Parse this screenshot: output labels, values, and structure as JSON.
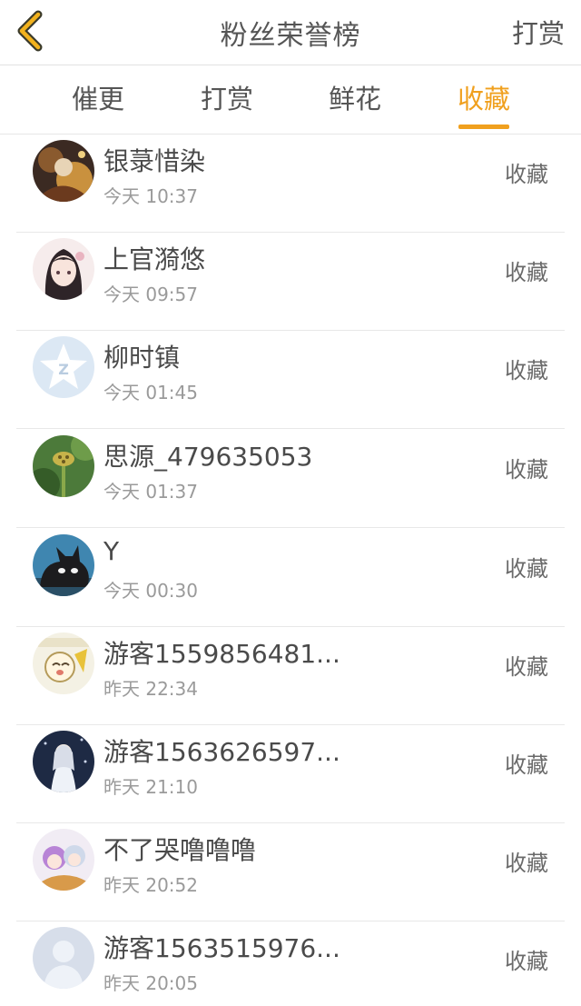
{
  "header": {
    "title": "粉丝荣誉榜",
    "action_label": "打赏",
    "back_icon": "chevron-left-icon",
    "accent_color": "#f0a01e"
  },
  "tabs": [
    {
      "label": "催更",
      "active": false
    },
    {
      "label": "打赏",
      "active": false
    },
    {
      "label": "鲜花",
      "active": false
    },
    {
      "label": "收藏",
      "active": true
    }
  ],
  "fans": [
    {
      "name": "银菉惜染",
      "time": "今天 10:37",
      "action": "收藏",
      "avatar": "anime-girl-dark-avatar"
    },
    {
      "name": "上官漪悠",
      "time": "今天 09:57",
      "action": "收藏",
      "avatar": "anime-girl-portrait-avatar"
    },
    {
      "name": "柳时镇",
      "time": "今天 01:45",
      "action": "收藏",
      "avatar": "qq-star-avatar"
    },
    {
      "name": "思源_479635053",
      "time": "今天 01:37",
      "action": "收藏",
      "avatar": "lotus-pod-avatar"
    },
    {
      "name": "Y",
      "time": "今天 00:30",
      "action": "收藏",
      "avatar": "black-cat-avatar"
    },
    {
      "name": "游客1559856481...",
      "time": "昨天 22:34",
      "action": "收藏",
      "avatar": "cartoon-sticker-avatar"
    },
    {
      "name": "游客1563626597...",
      "time": "昨天 21:10",
      "action": "收藏",
      "avatar": "white-dress-girl-avatar"
    },
    {
      "name": "不了哭噜噜噜",
      "time": "昨天 20:52",
      "action": "收藏",
      "avatar": "anime-chibi-avatar"
    },
    {
      "name": "游客1563515976...",
      "time": "昨天 20:05",
      "action": "收藏",
      "avatar": "default-person-avatar"
    }
  ]
}
